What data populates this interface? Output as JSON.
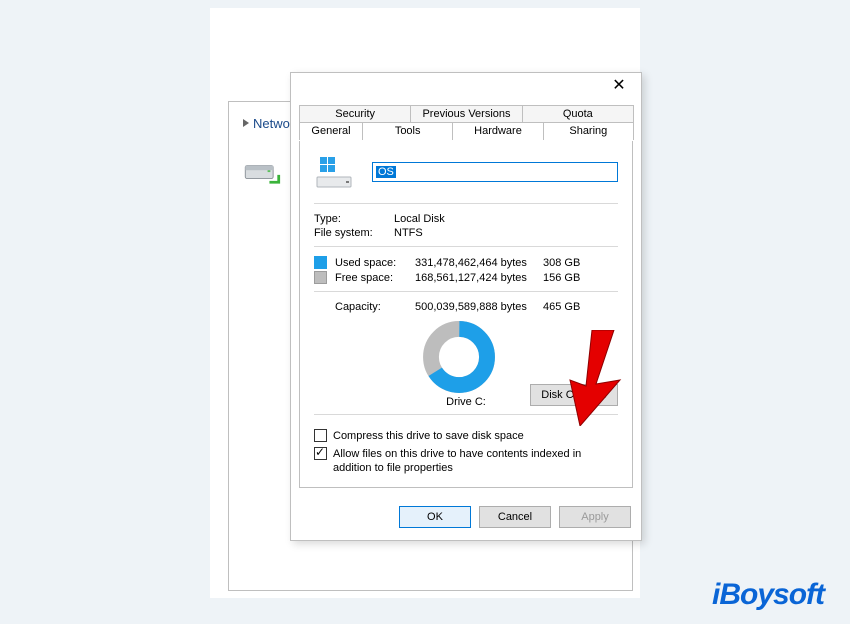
{
  "background": {
    "network_label": "Netwo",
    "drive_icon_name": "network-drive-icon"
  },
  "dialog": {
    "tabs_back": [
      "Security",
      "Previous Versions",
      "Quota"
    ],
    "tabs_front": [
      "General",
      "Tools",
      "Hardware",
      "Sharing"
    ],
    "disk_name": "OS",
    "type_label": "Type:",
    "type_value": "Local Disk",
    "fs_label": "File system:",
    "fs_value": "NTFS",
    "used_label": "Used space:",
    "used_bytes": "331,478,462,464 bytes",
    "used_gb": "308 GB",
    "free_label": "Free space:",
    "free_bytes": "168,561,127,424 bytes",
    "free_gb": "156 GB",
    "capacity_label": "Capacity:",
    "capacity_bytes": "500,039,589,888 bytes",
    "capacity_gb": "465 GB",
    "drive_label": "Drive C:",
    "cleanup_btn": "Disk Cleanup",
    "compress_label": "Compress this drive to save disk space",
    "index_label": "Allow files on this drive to have contents indexed in addition to file properties",
    "compress_checked": false,
    "index_checked": true,
    "ok": "OK",
    "cancel": "Cancel",
    "apply": "Apply"
  },
  "chart_data": {
    "type": "pie",
    "title": "Drive C:",
    "categories": [
      "Used space",
      "Free space"
    ],
    "values": [
      308,
      156
    ],
    "colors": [
      "#1e9fe8",
      "#bdbdbd"
    ],
    "unit": "GB",
    "total": 465
  },
  "brand": "iBoysoft"
}
